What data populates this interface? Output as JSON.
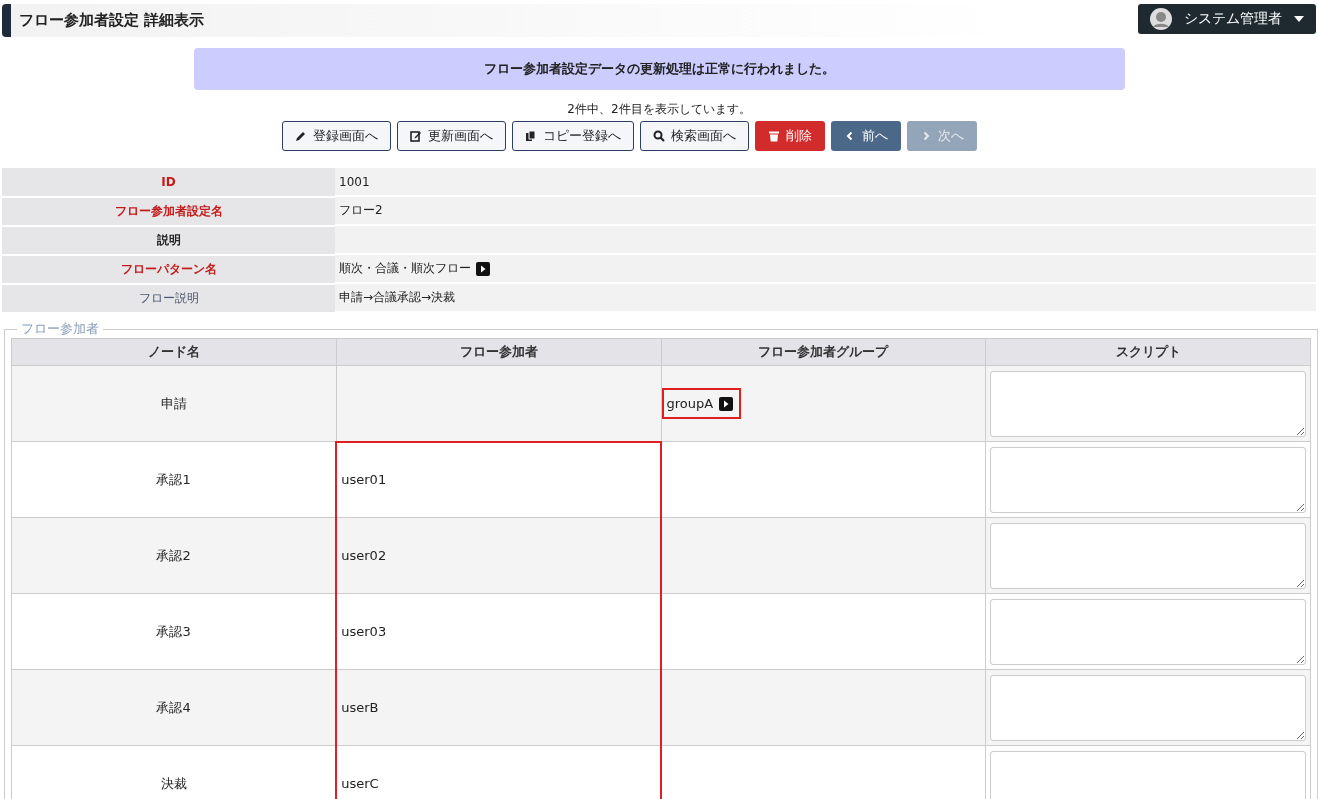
{
  "header": {
    "title": "フロー参加者設定 詳細表示",
    "user": "システム管理者"
  },
  "message": "フロー参加者設定データの更新処理は正常に行われました。",
  "record_count": "2件中、2件目を表示しています。",
  "buttons": [
    {
      "label": "登録画面へ",
      "kind": "outline",
      "disabled": false
    },
    {
      "label": "更新画面へ",
      "kind": "outline",
      "disabled": false
    },
    {
      "label": "コピー登録へ",
      "kind": "outline",
      "disabled": false
    },
    {
      "label": "検索画面へ",
      "kind": "outline",
      "disabled": false
    },
    {
      "label": "削除",
      "kind": "danger",
      "disabled": false
    },
    {
      "label": "前へ",
      "kind": "nav",
      "disabled": false
    },
    {
      "label": "次へ",
      "kind": "nav",
      "disabled": true
    }
  ],
  "details": [
    {
      "label": "ID",
      "value": "1001",
      "kind": "required"
    },
    {
      "label": "フロー参加者設定名",
      "value": "フロー2",
      "kind": "required"
    },
    {
      "label": "説明",
      "kind": "optional"
    },
    {
      "label": "フローパターン名",
      "value": "順次・合議・順次フロー",
      "kind": "required",
      "link": true
    },
    {
      "label": "フロー説明",
      "value": "申請→合議承認→決裁",
      "kind": "derived"
    }
  ],
  "participants": {
    "legend": "フロー参加者",
    "columns": [
      "ノード名",
      "フロー参加者",
      "フロー参加者グループ",
      "スクリプト"
    ],
    "rows": [
      {
        "node": "申請",
        "group": {
          "name": "groupA",
          "link": true,
          "highlighted": true
        },
        "participant_highlighted": false
      },
      {
        "node": "承認1",
        "participant": "user01",
        "participant_highlighted": true
      },
      {
        "node": "承認2",
        "participant": "user02",
        "participant_highlighted": true
      },
      {
        "node": "承認3",
        "participant": "user03",
        "participant_highlighted": true
      },
      {
        "node": "承認4",
        "participant": "userB",
        "participant_highlighted": true
      },
      {
        "node": "決裁",
        "participant": "userC",
        "participant_highlighted": true
      }
    ]
  }
}
